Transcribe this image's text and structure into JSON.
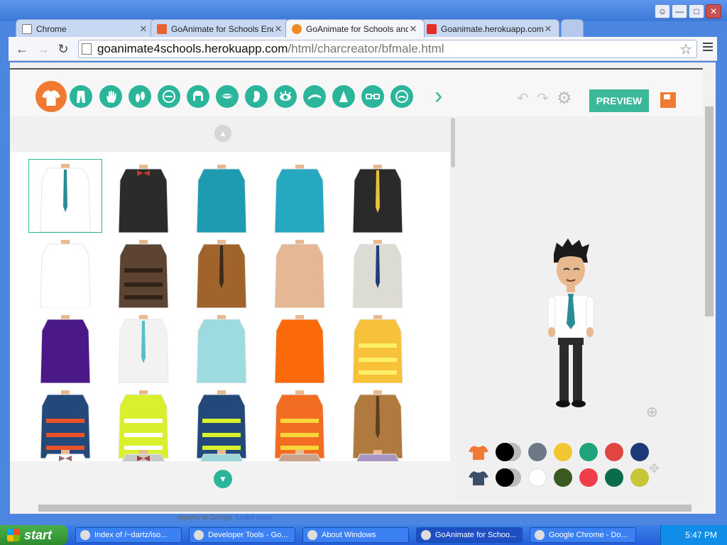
{
  "browser": {
    "tabs": [
      {
        "label": "Chrome",
        "icon": "page-icon",
        "color": "#ffffff"
      },
      {
        "label": "GoAnimate for Schools End-of",
        "icon": "goanimate-v-icon",
        "color": "#e8632c"
      },
      {
        "label": "GoAnimate for Schools and B",
        "icon": "goanimate-icon",
        "color": "#f08a24",
        "active": true
      },
      {
        "label": "Goanimate.herokuapp.com g",
        "icon": "youtube-icon",
        "color": "#e52d27"
      }
    ],
    "url_host": "goanimate4schools.herokuapp.com",
    "url_path": "/html/charcreator/bfmale.html"
  },
  "toolbar": {
    "next_label": "›",
    "preview_label": "PREVIEW"
  },
  "categories": [
    "shirt",
    "pants",
    "hand",
    "shoes",
    "face",
    "hair",
    "mouth",
    "ear",
    "eye",
    "eyebrow",
    "nose",
    "glasses",
    "mustache"
  ],
  "grid": {
    "items": [
      {
        "name": "white-shirt-teal-tie",
        "body": "#ffffff",
        "detail": "#2a8c95",
        "type": "tie"
      },
      {
        "name": "black-tuxedo-bowtie",
        "body": "#2b2b2b",
        "detail": "#c0392b",
        "type": "bow"
      },
      {
        "name": "teal-tshirt",
        "body": "#1e9ab1",
        "detail": "#1e9ab1",
        "type": "plain"
      },
      {
        "name": "teal-polo",
        "body": "#26a8c0",
        "detail": "#1b8aa0",
        "type": "plain"
      },
      {
        "name": "black-suit-yellow-tie",
        "body": "#2a2a2a",
        "detail": "#e8c33a",
        "type": "tie"
      },
      {
        "name": "white-longsleeve",
        "body": "#ffffff",
        "detail": "#dde8f0",
        "type": "plain"
      },
      {
        "name": "brown-striped-sweater",
        "body": "#5c4332",
        "detail": "#2e2219",
        "type": "stripes"
      },
      {
        "name": "brown-suit",
        "body": "#a0632b",
        "detail": "#3b2a1a",
        "type": "tie"
      },
      {
        "name": "bare-chest",
        "body": "#e6b794",
        "detail": "#d9a37e",
        "type": "plain"
      },
      {
        "name": "officer-uniform",
        "body": "#dcdcd5",
        "detail": "#1f3b7a",
        "type": "tie"
      },
      {
        "name": "purple-polo",
        "body": "#4b1888",
        "detail": "#3a1070",
        "type": "plain"
      },
      {
        "name": "white-labcoat",
        "body": "#f2f2f2",
        "detail": "#55c0c8",
        "type": "tie"
      },
      {
        "name": "light-blue-scrubs",
        "body": "#9edbe0",
        "detail": "#7cc7cd",
        "type": "plain"
      },
      {
        "name": "orange-jumpsuit",
        "body": "#fa6a0a",
        "detail": "#ffffff",
        "type": "plain"
      },
      {
        "name": "firefighter-jacket",
        "body": "#f8c13a",
        "detail": "#fff06a",
        "type": "stripes"
      },
      {
        "name": "blue-harness-uniform",
        "body": "#23487a",
        "detail": "#e8532a",
        "type": "stripes"
      },
      {
        "name": "yellow-hivis-jacket",
        "body": "#d9f02d",
        "detail": "#ffffff",
        "type": "stripes"
      },
      {
        "name": "blue-hivis-vest",
        "body": "#23487a",
        "detail": "#d9f02d",
        "type": "stripes"
      },
      {
        "name": "orange-safety-vest",
        "body": "#f26d22",
        "detail": "#f8d53a",
        "type": "stripes"
      },
      {
        "name": "brown-trenchcoat",
        "body": "#b07a3e",
        "detail": "#5c3e1e",
        "type": "tie"
      },
      {
        "name": "white-suspenders",
        "body": "#ffffff",
        "detail": "#9b6a6a",
        "type": "bow"
      },
      {
        "name": "grey-vest-bowtie",
        "body": "#c8c8c8",
        "detail": "#a0443a",
        "type": "bow"
      },
      {
        "name": "teal-vest",
        "body": "#9ad6d8",
        "detail": "#2bb59a",
        "type": "plain"
      },
      {
        "name": "brown-varsity",
        "body": "#c8a28a",
        "detail": "#ffffff",
        "type": "plain"
      },
      {
        "name": "lavender-vest",
        "body": "#a896c2",
        "detail": "#ffffff",
        "type": "plain"
      }
    ]
  },
  "swatches": {
    "primary": [
      "#000000",
      "#6d7a85",
      "#f2c832",
      "#1fa37d",
      "#df4641",
      "#1c3a78"
    ],
    "secondary": [
      "#000000",
      "#ffffff",
      "#3a5a22",
      "#ef3d4a",
      "#0b6b4b",
      "#c7c639"
    ]
  },
  "status": {
    "text": "reports to Google.",
    "learn": "Learn more"
  },
  "taskbar": {
    "start_label": "start",
    "tasks": [
      {
        "label": "Index of /~dartz/iso..."
      },
      {
        "label": "Developer Tools - Go..."
      },
      {
        "label": "About Windows"
      },
      {
        "label": "GoAnimate for Schoo...",
        "active": true
      },
      {
        "label": "Google Chrome - Do..."
      }
    ],
    "clock": "5:47 PM"
  }
}
